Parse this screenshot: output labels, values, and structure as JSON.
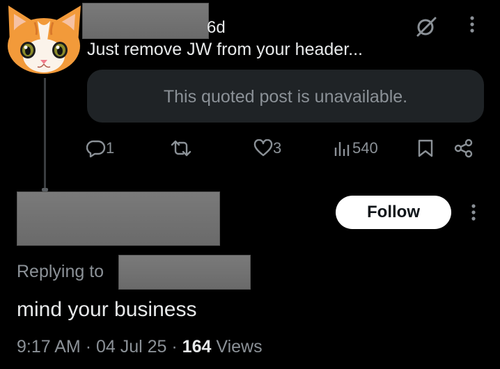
{
  "tweet": {
    "time_ago": "6d",
    "text": "Just remove JW from your header...",
    "quote_unavailable": "This quoted post is unavailable.",
    "reply_count": "1",
    "like_count": "3",
    "view_count": "540"
  },
  "follow_button_label": "Follow",
  "reply": {
    "replying_to_label": "Replying to",
    "text": "mind your business",
    "time": "9:17 AM",
    "date": "04 Jul 25",
    "sep": "·",
    "views_count": "164",
    "views_label": "Views"
  },
  "icons": {
    "avatar": "cat-avatar-icon",
    "grok": "grok-icon",
    "more": "more-vertical-icon",
    "reply": "reply-icon",
    "retweet": "retweet-icon",
    "like": "heart-icon",
    "views": "bar-chart-icon",
    "bookmark": "bookmark-icon",
    "share": "share-icon"
  },
  "colors": {
    "background": "#000000",
    "primary_text": "#e7e9ea",
    "secondary_text": "#8b9197",
    "quote_box": "#1f2326",
    "follow_button": "#ffffff"
  }
}
